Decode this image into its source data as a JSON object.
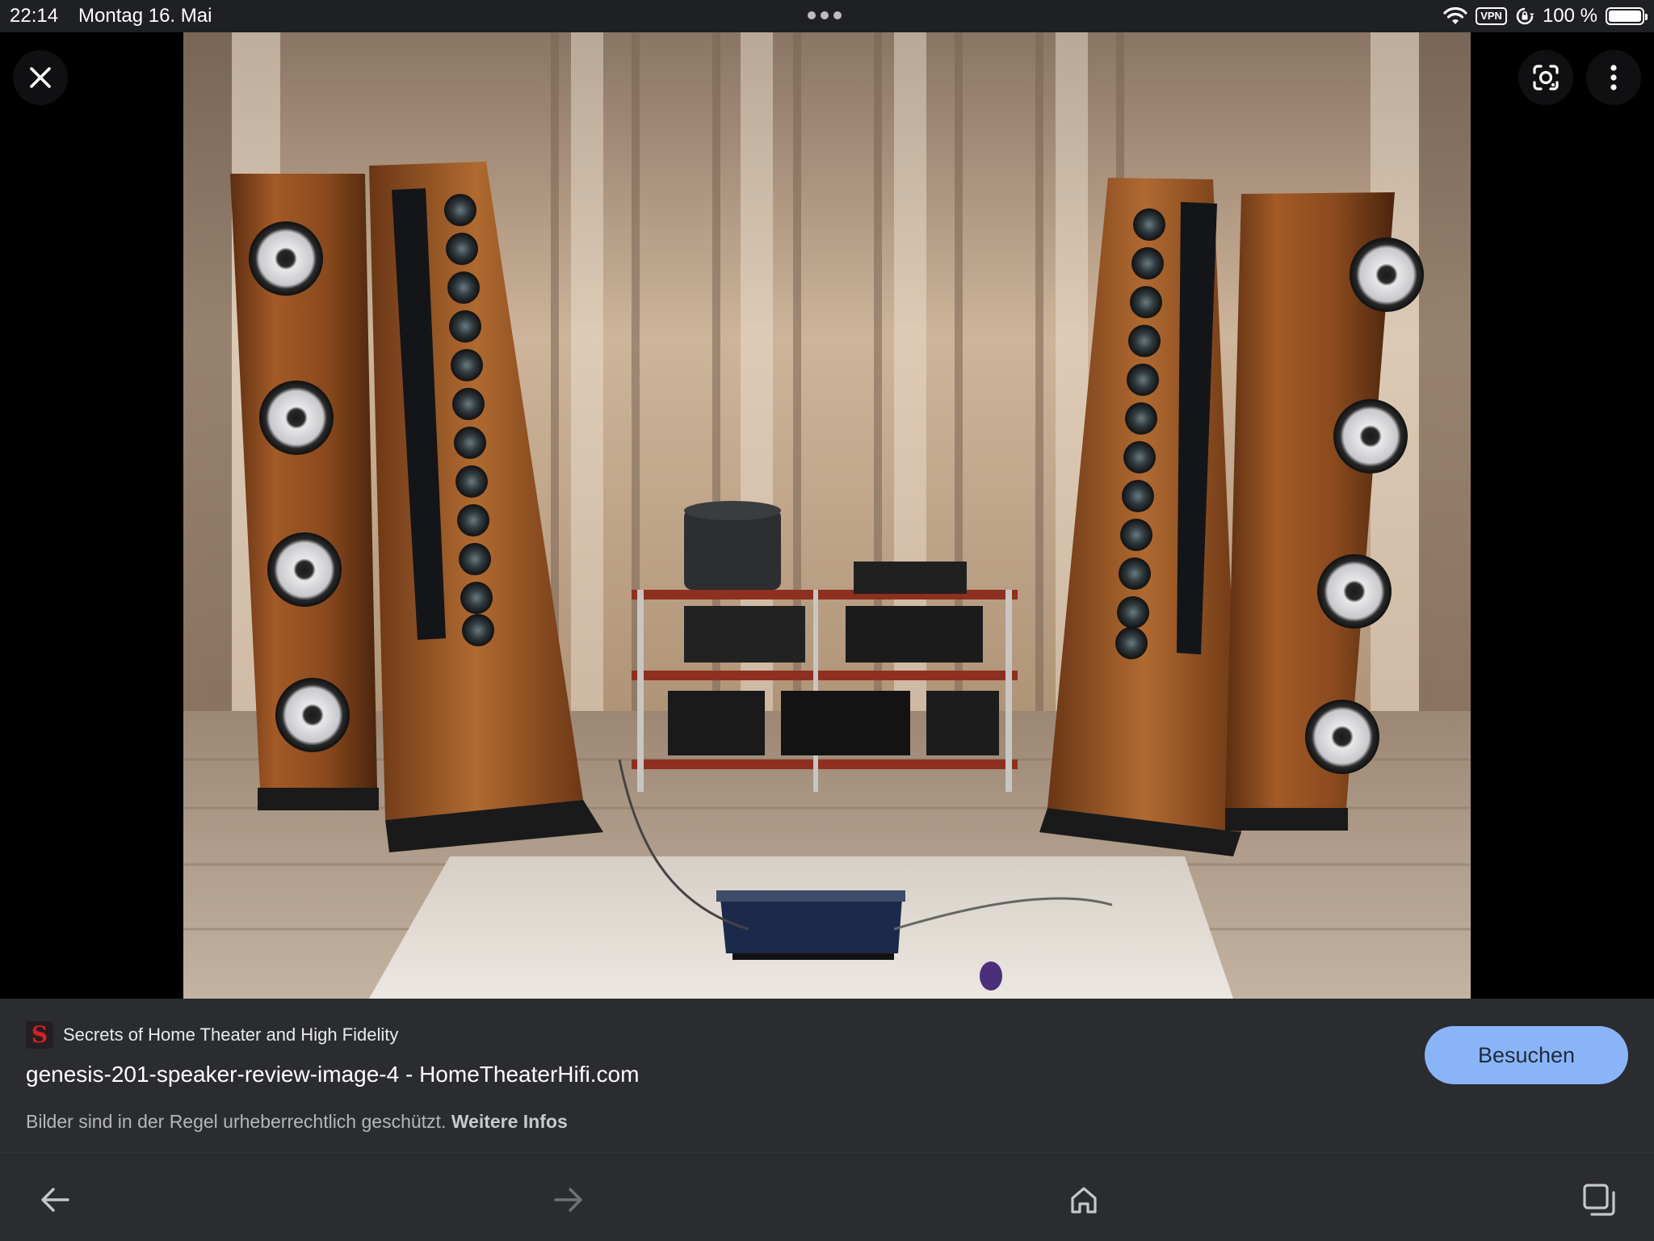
{
  "status_bar": {
    "time": "22:14",
    "date": "Montag 16. Mai",
    "vpn": "VPN",
    "battery": "100 %",
    "battery_level": 1.0
  },
  "viewer": {
    "close_icon": "close-icon",
    "lens_icon": "google-lens-icon",
    "more_icon": "more-vert-icon"
  },
  "info": {
    "favicon_letter": "S",
    "source_name": "Secrets of Home Theater and High Fidelity",
    "title": "genesis-201-speaker-review-image-4 - HomeTheaterHifi.com",
    "visit_label": "Besuchen",
    "copyright_text": "Bilder sind in der Regel urheberrechtlich geschützt.",
    "copyright_link": "Weitere Infos"
  },
  "bottom_nav": {
    "back_icon": "back-arrow-icon",
    "forward_icon": "forward-arrow-icon",
    "home_icon": "home-icon",
    "tabs_icon": "tabs-icon"
  },
  "colors": {
    "accent": "#8ab4f8",
    "panel_bg": "#2b2c30",
    "status_bg": "#1f2023",
    "viewer_bg": "#000000",
    "favicon_red": "#d32027"
  }
}
